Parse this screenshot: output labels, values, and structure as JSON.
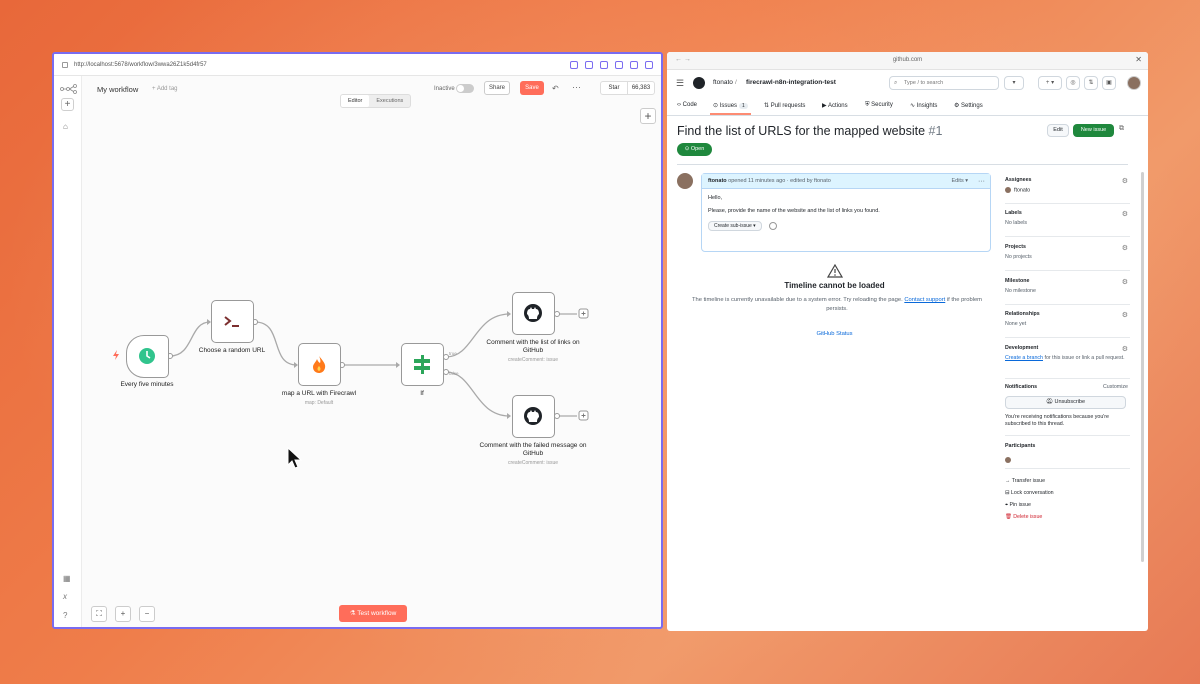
{
  "left_window": {
    "url": "http://localhost:5678/workflow/3wwa26Z1k5d4fr57",
    "workflow_name": "My workflow",
    "add_tag": "+ Add tag",
    "inactive_label": "Inactive",
    "share_label": "Share",
    "save_label": "Save",
    "star_label": "Star",
    "star_count": "66,383",
    "tabs": [
      "Editor",
      "Executions"
    ],
    "active_tab": "Editor",
    "nodes": {
      "trigger": {
        "label": "Every five minutes"
      },
      "code": {
        "label": "Choose a random URL"
      },
      "firecrawl": {
        "label": "map a URL with Firecrawl",
        "sub": "map: Default"
      },
      "if": {
        "label": "If",
        "true_label": "true",
        "false_label": "false"
      },
      "gh1": {
        "label": "Comment with the list of links on GitHub",
        "sub": "createComment: issue"
      },
      "gh2": {
        "label": "Comment with the failed message on GitHub",
        "sub": "createComment: issue"
      }
    },
    "test_button": "Test workflow"
  },
  "right_window": {
    "address": "github.com",
    "owner": "ftonato",
    "repo": "firecrawl-n8n-integration-test",
    "search_placeholder": "Type / to search",
    "tabs": [
      {
        "label": "Code"
      },
      {
        "label": "Issues",
        "count": "1"
      },
      {
        "label": "Pull requests"
      },
      {
        "label": "Actions"
      },
      {
        "label": "Security"
      },
      {
        "label": "Insights"
      },
      {
        "label": "Settings"
      }
    ],
    "issue_title": "Find the list of URLS for the mapped website",
    "issue_number": "#1",
    "edit_label": "Edit",
    "new_issue_label": "New issue",
    "status": "Open",
    "comment": {
      "author": "ftonato",
      "meta": "opened 11 minutes ago · edited by ftonato",
      "edits": "Edits",
      "line1": "Hello,",
      "line2": "Please, provide the name of the website and the list of links you found.",
      "subissue": "Create sub-issue"
    },
    "timeline": {
      "title": "Timeline cannot be loaded",
      "desc_start": "The timeline is currently unavailable due to a system error. Try reloading the page.",
      "contact": "Contact support",
      "desc_end": "if the problem persists.",
      "status_link": "GitHub Status"
    },
    "sidebar": {
      "assignees": {
        "title": "Assignees",
        "value": "ftonato"
      },
      "labels": {
        "title": "Labels",
        "value": "No labels"
      },
      "projects": {
        "title": "Projects",
        "value": "No projects"
      },
      "milestone": {
        "title": "Milestone",
        "value": "No milestone"
      },
      "relationships": {
        "title": "Relationships",
        "value": "None yet"
      },
      "development": {
        "title": "Development",
        "link": "Create a branch",
        "value": "for this issue or link a pull request."
      },
      "notifications": {
        "title": "Notifications",
        "customize": "Customize",
        "button": "Unsubscribe",
        "note": "You're receiving notifications because you're subscribed to this thread."
      },
      "participants": {
        "title": "Participants"
      },
      "actions": [
        "Transfer issue",
        "Lock conversation",
        "Pin issue",
        "Delete issue"
      ]
    }
  }
}
